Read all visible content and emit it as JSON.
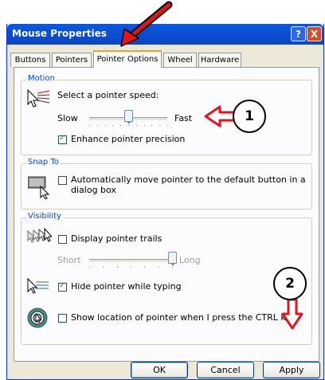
{
  "window": {
    "title": "Mouse Properties"
  },
  "titlebar_buttons": {
    "help": "?",
    "close": "X"
  },
  "tabs": [
    {
      "label": "Buttons",
      "active": false
    },
    {
      "label": "Pointers",
      "active": false
    },
    {
      "label": "Pointer Options",
      "active": true
    },
    {
      "label": "Wheel",
      "active": false
    },
    {
      "label": "Hardware",
      "active": false
    }
  ],
  "motion": {
    "group_label": "Motion",
    "speed_label": "Select a pointer speed:",
    "slow_label": "Slow",
    "fast_label": "Fast",
    "speed_value": 0.5,
    "enhance": {
      "label": "Enhance pointer precision",
      "checked": true
    }
  },
  "snap_to": {
    "group_label": "Snap To",
    "option": {
      "label_line1": "Automatically move pointer to the default button in a",
      "label_line2": "dialog box",
      "checked": false
    }
  },
  "visibility": {
    "group_label": "Visibility",
    "trails": {
      "label": "Display pointer trails",
      "checked": false,
      "short_label": "Short",
      "long_label": "Long",
      "value": 1.0,
      "enabled": false
    },
    "hide": {
      "label": "Hide pointer while typing",
      "checked": true
    },
    "ctrl": {
      "label": "Show location of pointer when I press the CTRL key",
      "checked": false
    }
  },
  "buttons": {
    "ok": "OK",
    "cancel": "Cancel",
    "apply": "Apply"
  },
  "annotations": {
    "callout_1": "1",
    "callout_2": "2",
    "arrow_color": "#e0161f"
  }
}
